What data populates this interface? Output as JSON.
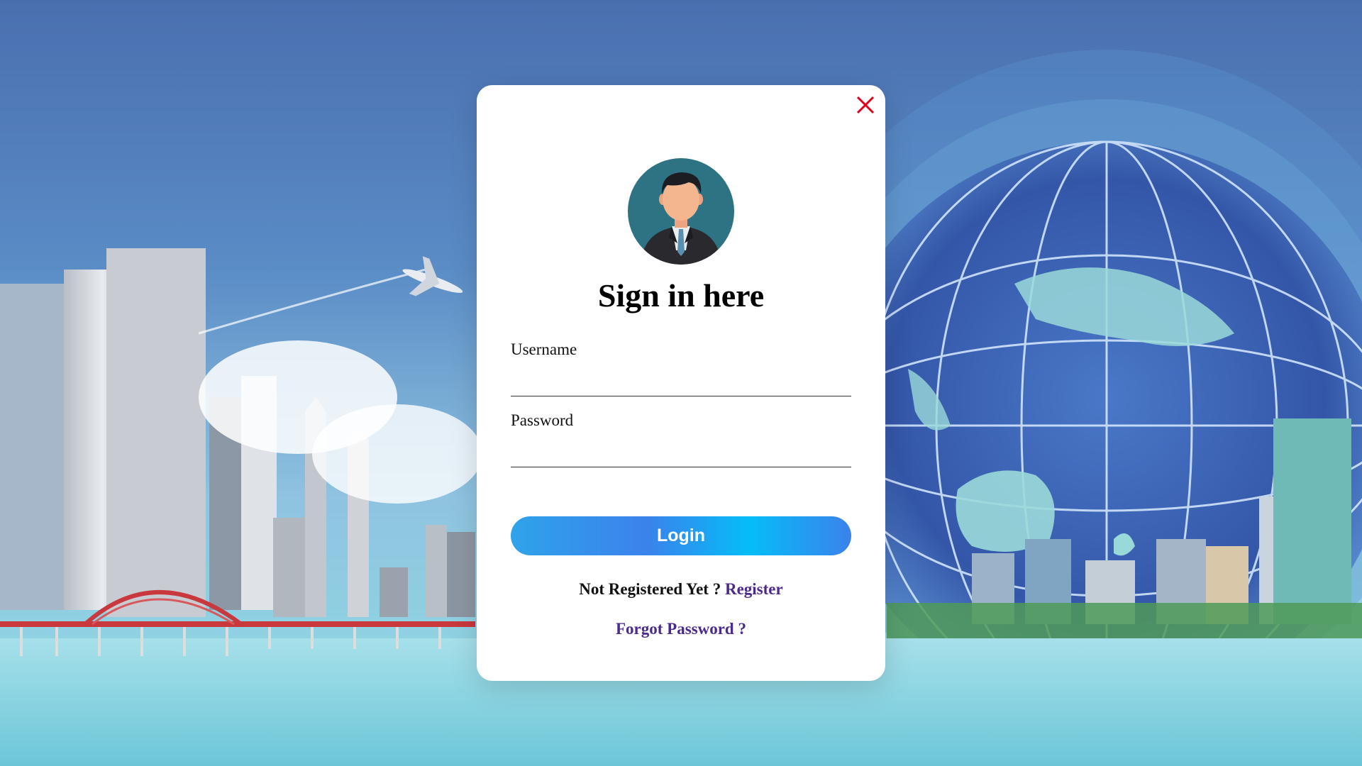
{
  "modal": {
    "title": "Sign in here",
    "username_label": "Username",
    "username_value": "",
    "password_label": "Password",
    "password_value": "",
    "login_label": "Login",
    "register_prompt": "Not Registered Yet ?",
    "register_link": "Register",
    "forgot_link": "Forgot Password ?"
  },
  "icons": {
    "close": "close-icon",
    "avatar": "user-avatar-icon"
  },
  "colors": {
    "close": "#e3001b",
    "link": "#4b2a8c",
    "button_gradient_start": "#2fa3ea",
    "button_gradient_mid": "#05bdf7",
    "avatar_bg": "#2e7383"
  }
}
